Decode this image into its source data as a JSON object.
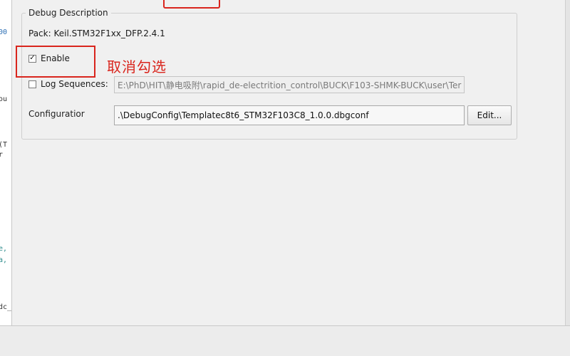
{
  "editor_fragments": [
    {
      "text": "00",
      "cls": "blue"
    },
    {
      "text": "ou",
      "cls": ""
    },
    {
      "text": "(T",
      "cls": ""
    },
    {
      "text": "r",
      "cls": ""
    },
    {
      "text": "e,",
      "cls": "teal"
    },
    {
      "text": "a,",
      "cls": "teal"
    },
    {
      "text": "dc_",
      "cls": ""
    }
  ],
  "debug_description": {
    "title": "Debug Description",
    "pack": "Pack:  Keil.STM32F1xx_DFP.2.4.1",
    "enable": {
      "label": "Enable",
      "checked": true,
      "mark": "✓"
    },
    "annotation": "取消勾选",
    "log_sequences": {
      "label": "Log Sequences:",
      "checked": false,
      "path": "E:\\PhD\\HIT\\静电吸附\\rapid_de-electrition_control\\BUCK\\F103-SHMK-BUCK\\user\\Ter"
    },
    "configuration": {
      "label": "Configuratior",
      "value": ".\\DebugConfig\\Templatec8t6_STM32F103C8_1.0.0.dbgconf",
      "edit_button": "Edit..."
    }
  },
  "colors": {
    "annotation_red": "#d9251d",
    "dialog_bg": "#f0f0f0"
  }
}
